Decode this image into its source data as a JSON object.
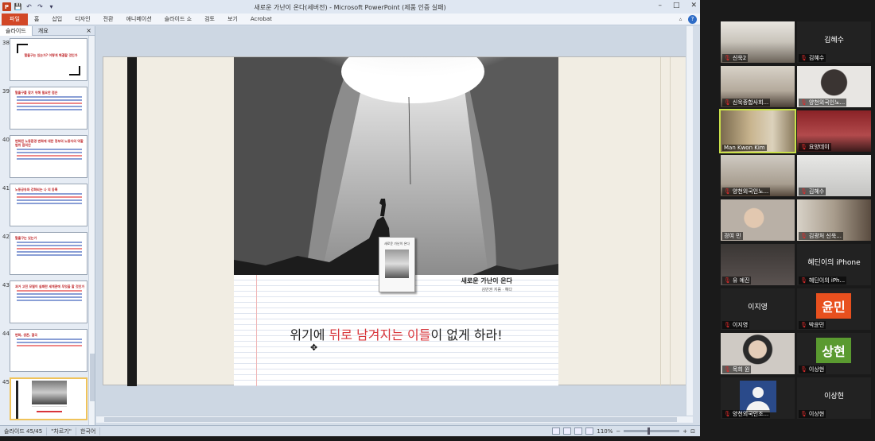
{
  "window": {
    "title": "새로운 가난이 온다(세버전) - Microsoft PowerPoint (제품 인증 실패)",
    "controls": [
      "–",
      "□",
      "✕"
    ]
  },
  "ribbon": {
    "tabs": [
      "파일",
      "홈",
      "삽입",
      "디자인",
      "전환",
      "애니메이션",
      "슬라이드 쇼",
      "검토",
      "보기",
      "Acrobat"
    ]
  },
  "panel": {
    "tabs": [
      "슬라이드",
      "개요"
    ],
    "close": "×",
    "slides": [
      {
        "num": "38",
        "title": "탈출구는 있는가? 어떻게 해결할 것인가"
      },
      {
        "num": "39",
        "title": "탈출구를 찾기 위해 필요한 점은"
      },
      {
        "num": "40",
        "title": "변화된 노동환경 변화에 대한 정부의 노동자의 역할 범위 합의안"
      },
      {
        "num": "41",
        "title": "노동공유와 강화되는 나 의 등록"
      },
      {
        "num": "42",
        "title": "탈출구는 있는가"
      },
      {
        "num": "43",
        "title": "과거 고전 모델이 실패한 세계관에 무엇을 할 것인가"
      },
      {
        "num": "44",
        "title": "변화, 생존, 결국"
      },
      {
        "num": "45",
        "title": ""
      }
    ]
  },
  "slide": {
    "book_title": "새로운 가난이 온다",
    "book_author": "김만권 지음 · 혜다",
    "book_cover_title": "새로운 가난이 온다",
    "headline_pre": "위기에 ",
    "headline_red": "뒤로 남겨지는 이들",
    "headline_post": "이 없게 하라!"
  },
  "status": {
    "slide_info": "슬라이드 45/45",
    "theme": "\"차르기\"",
    "language": "한국어",
    "zoom": "110%"
  },
  "participants": [
    {
      "name": "신욱2",
      "kind": "video"
    },
    {
      "name": "김혜수",
      "kind": "name",
      "label": "김혜수"
    },
    {
      "name": "신욱종합사회...",
      "kind": "video"
    },
    {
      "name": "양천외국인노...",
      "kind": "video"
    },
    {
      "name": "Man Kwon Kim",
      "kind": "video",
      "active": true
    },
    {
      "name": "요양데이",
      "kind": "video"
    },
    {
      "name": "양천외국인노...",
      "kind": "video"
    },
    {
      "name": "김혜수",
      "kind": "video"
    },
    {
      "name": "경여 민",
      "kind": "video"
    },
    {
      "name": "김광처 신욱...",
      "kind": "video"
    },
    {
      "name": "유 예진",
      "kind": "video"
    },
    {
      "name": "혜딘이의 iPh...",
      "kind": "name",
      "label": "혜딘이의 iPhone"
    },
    {
      "name": "이지영",
      "kind": "name",
      "label": "이지영"
    },
    {
      "name": "박윤민",
      "kind": "avatar",
      "label": "윤민",
      "color": "#e8501e"
    },
    {
      "name": "목희 원",
      "kind": "video"
    },
    {
      "name": "이상현",
      "kind": "avatar",
      "label": "상현",
      "color": "#5a9a30"
    },
    {
      "name": "양천외국인조...",
      "kind": "profile"
    },
    {
      "name": "이상현",
      "kind": "name",
      "label": "이상현"
    }
  ],
  "colors": {
    "file_tab": "#d24726",
    "headline_red": "#d8343a",
    "active_speaker": "#c9e04a"
  }
}
